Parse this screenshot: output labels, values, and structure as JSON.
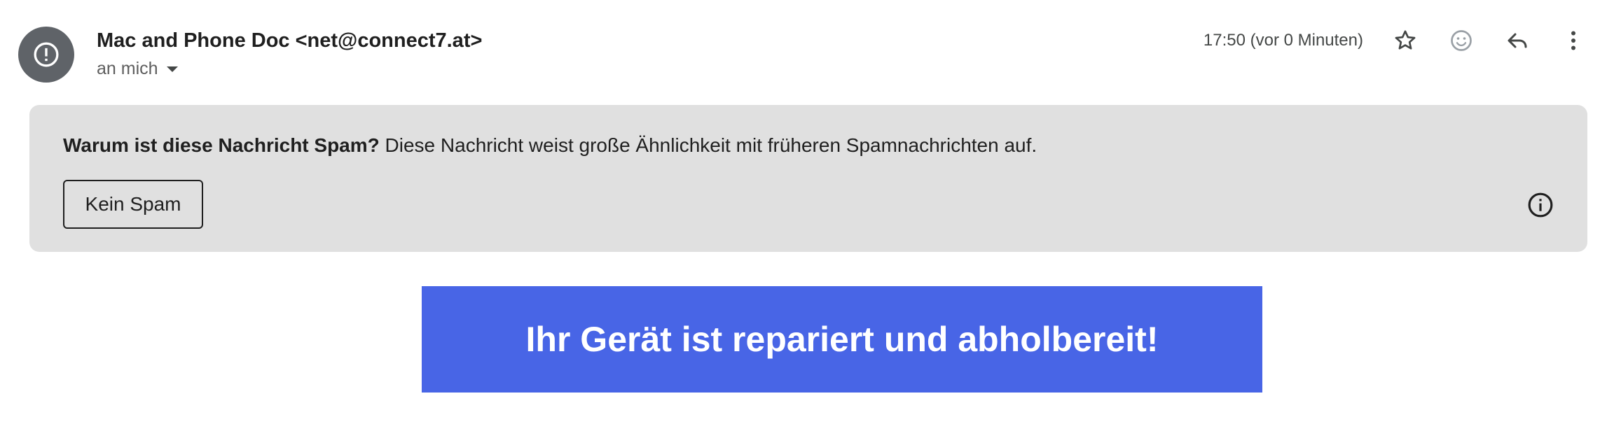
{
  "header": {
    "avatar_icon": "alert-circle-icon",
    "sender": "Mac and Phone Doc <net@connect7.at>",
    "recipient": "an mich",
    "timestamp": "17:50 (vor 0 Minuten)",
    "actions": [
      "star-icon",
      "emoji-icon",
      "reply-icon",
      "more-vert-icon"
    ]
  },
  "spam_warning": {
    "question": "Warum ist diese Nachricht Spam?",
    "explanation": " Diese Nachricht weist große Ähnlichkeit mit früheren Spamnachrichten auf.",
    "not_spam_label": "Kein Spam",
    "info_icon": "info-icon"
  },
  "body": {
    "headline": "Ihr Gerät ist repariert und abholbereit!",
    "banner_color": "#4865e6"
  },
  "colors": {
    "spam_banner_bg": "#e0e0e0",
    "avatar_bg": "#5f6368"
  }
}
